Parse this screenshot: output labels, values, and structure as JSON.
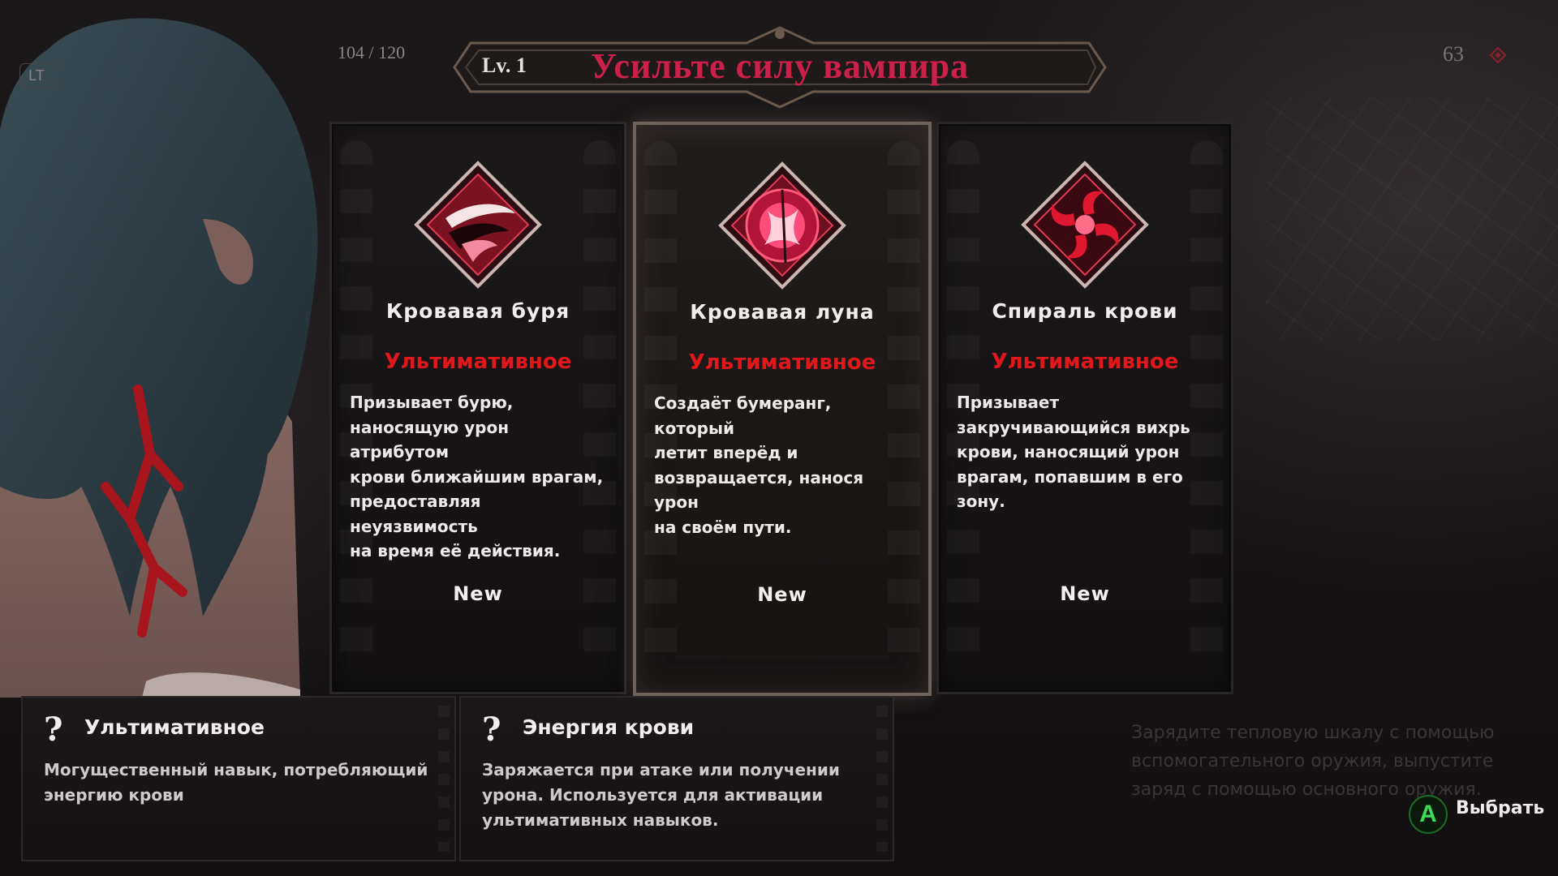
{
  "hud": {
    "lt_label": "LT",
    "hp_text": "104 / 120",
    "score": "63",
    "score_icon": "blood-gem-icon"
  },
  "banner": {
    "level": "Lv. 1",
    "title": "Усильте силу вампира"
  },
  "cards": [
    {
      "icon": "blood-storm-icon",
      "name": "Кровавая буря",
      "rarity": "Ультимативное",
      "desc_lines": [
        "Призывает бурю,",
        "наносящую урон атрибутом",
        "крови ближайшим врагам,",
        "предоставляя неуязвимость",
        "на время её действия."
      ],
      "tag": "New",
      "selected": false
    },
    {
      "icon": "blood-moon-icon",
      "name": "Кровавая луна",
      "rarity": "Ультимативное",
      "desc_lines": [
        "Создаёт бумеранг, который",
        "летит вперёд и",
        "возвращается, нанося урон",
        "на своём пути."
      ],
      "tag": "New",
      "selected": true
    },
    {
      "icon": "blood-spiral-icon",
      "name": "Спираль крови",
      "rarity": "Ультимативное",
      "desc_lines": [
        "Призывает",
        "закручивающийся вихрь",
        "крови, наносящий урон",
        "врагам, попавшим в его",
        "зону."
      ],
      "tag": "New",
      "selected": false
    }
  ],
  "info_panels": [
    {
      "icon": "?",
      "title": "Ультимативное",
      "body_lines": [
        "Могущественный навык, потребляющий",
        "энергию крови"
      ]
    },
    {
      "icon": "?",
      "title": "Энергия крови",
      "body_lines": [
        "Заряжается при атаке или получении",
        "урона. Используется для активации",
        "ультимативных навыков."
      ]
    }
  ],
  "hint_lines": [
    "Зарядите тепловую шкалу с помощью",
    "вспомогательного оружия, выпустите",
    "заряд с помощью основного оружия."
  ],
  "action": {
    "button": "A",
    "label": "Выбрать"
  },
  "colors": {
    "title": "#cc1f4a",
    "rarity": "#e0181c",
    "accent_button": "#3ddc55"
  }
}
